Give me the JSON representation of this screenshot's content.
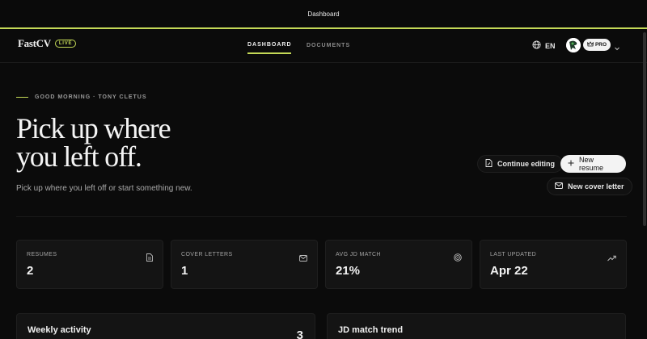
{
  "window": {
    "title": "Dashboard"
  },
  "brand": {
    "name": "FastCV",
    "badge": "LIVE"
  },
  "nav": {
    "tabs": [
      {
        "label": "DASHBOARD"
      },
      {
        "label": "DOCUMENTS"
      }
    ],
    "active_tab": "DASHBOARD"
  },
  "header": {
    "language": "EN",
    "plan_badge": "PRO"
  },
  "hero": {
    "greeting": "GOOD MORNING · TONY CLETUS",
    "headline_line1": "Pick up where",
    "headline_line2": "you left off.",
    "subtitle": "Pick up where you left off or start something new."
  },
  "actions": {
    "continue_label": "Continue editing",
    "new_resume_label": "New resume",
    "new_cover_label": "New cover letter"
  },
  "stats": [
    {
      "label": "RESUMES",
      "value": "2",
      "icon": "document-icon"
    },
    {
      "label": "COVER LETTERS",
      "value": "1",
      "icon": "mail-icon"
    },
    {
      "label": "AVG JD MATCH",
      "value": "21%",
      "icon": "target-icon"
    },
    {
      "label": "LAST UPDATED",
      "value": "Apr 22",
      "icon": "trending-up-icon"
    }
  ],
  "panels": {
    "weekly": {
      "title": "Weekly activity",
      "count": "3"
    },
    "trend": {
      "title": "JD match trend"
    }
  },
  "colors": {
    "accent": "#c4d957",
    "background": "#0b0b0b",
    "card": "#141414"
  }
}
